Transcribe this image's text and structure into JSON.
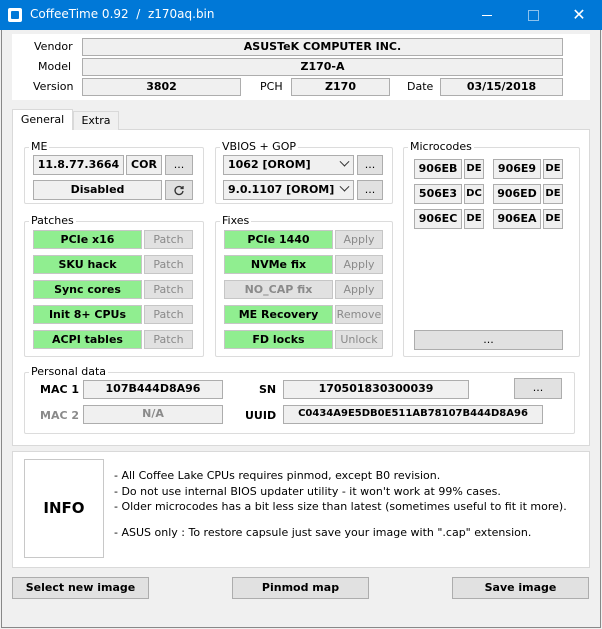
{
  "window": {
    "title": "CoffeeTime 0.92  /  z170aq.bin",
    "close_glyph": "✕"
  },
  "board": {
    "vendor_label": "Vendor",
    "vendor": "ASUSTeK COMPUTER INC.",
    "model_label": "Model",
    "model": "Z170-A",
    "version_label": "Version",
    "version": "3802",
    "pch_label": "PCH",
    "pch": "Z170",
    "date_label": "Date",
    "date": "03/15/2018"
  },
  "tabs": [
    "General",
    "Extra"
  ],
  "me": {
    "title": "ME",
    "version": "11.8.77.3664",
    "sku": "COR",
    "more": "...",
    "state": "Disabled"
  },
  "vbios": {
    "title": "VBIOS + GOP",
    "vbios_value": "1062 [OROM]",
    "gop_value": "9.0.1107 [OROM]",
    "more1": "...",
    "more2": "..."
  },
  "microcodes": {
    "title": "Microcodes",
    "items": [
      {
        "cpuid": "906EB",
        "tag": "DE"
      },
      {
        "cpuid": "906E9",
        "tag": "DE"
      },
      {
        "cpuid": "506E3",
        "tag": "DC"
      },
      {
        "cpuid": "906ED",
        "tag": "DE"
      },
      {
        "cpuid": "906EC",
        "tag": "DE"
      },
      {
        "cpuid": "906EA",
        "tag": "DE"
      }
    ],
    "more": "..."
  },
  "patches": {
    "title": "Patches",
    "items": [
      {
        "name": "PCIe x16",
        "action": "Patch"
      },
      {
        "name": "SKU hack",
        "action": "Patch"
      },
      {
        "name": "Sync cores",
        "action": "Patch"
      },
      {
        "name": "Init 8+ CPUs",
        "action": "Patch"
      },
      {
        "name": "ACPI tables",
        "action": "Patch"
      }
    ]
  },
  "fixes": {
    "title": "Fixes",
    "items": [
      {
        "name": "PCIe 1440",
        "action": "Apply",
        "applied": true
      },
      {
        "name": "NVMe fix",
        "action": "Apply",
        "applied": true
      },
      {
        "name": "NO_CAP fix",
        "action": "Apply",
        "applied": false
      },
      {
        "name": "ME Recovery",
        "action": "Remove",
        "applied": true
      },
      {
        "name": "FD locks",
        "action": "Unlock",
        "applied": true
      }
    ]
  },
  "personal": {
    "title": "Personal data",
    "mac1_label": "MAC 1",
    "mac1": "107B444D8A96",
    "mac2_label": "MAC 2",
    "mac2": "N/A",
    "sn_label": "SN",
    "sn": "170501830300039",
    "uuid_label": "UUID",
    "uuid": "C0434A9E5DB0E511AB78107B444D8A96",
    "more": "..."
  },
  "info": {
    "title": "INFO",
    "lines": [
      "- All Coffee Lake CPUs requires pinmod, except B0 revision.",
      "- Do not use internal BIOS updater utility - it won't work at 99% cases.",
      "- Older microcodes has a bit less size than latest (sometimes useful to fit it more).",
      "- ASUS only : To restore capsule just save your image with \".cap\" extension."
    ]
  },
  "buttons": {
    "select": "Select new image",
    "pinmod": "Pinmod map",
    "save": "Save image"
  },
  "colors": {
    "titlebar": "#0078d7",
    "enabled": "#90ee90",
    "disabled": "#e1e1e1"
  }
}
